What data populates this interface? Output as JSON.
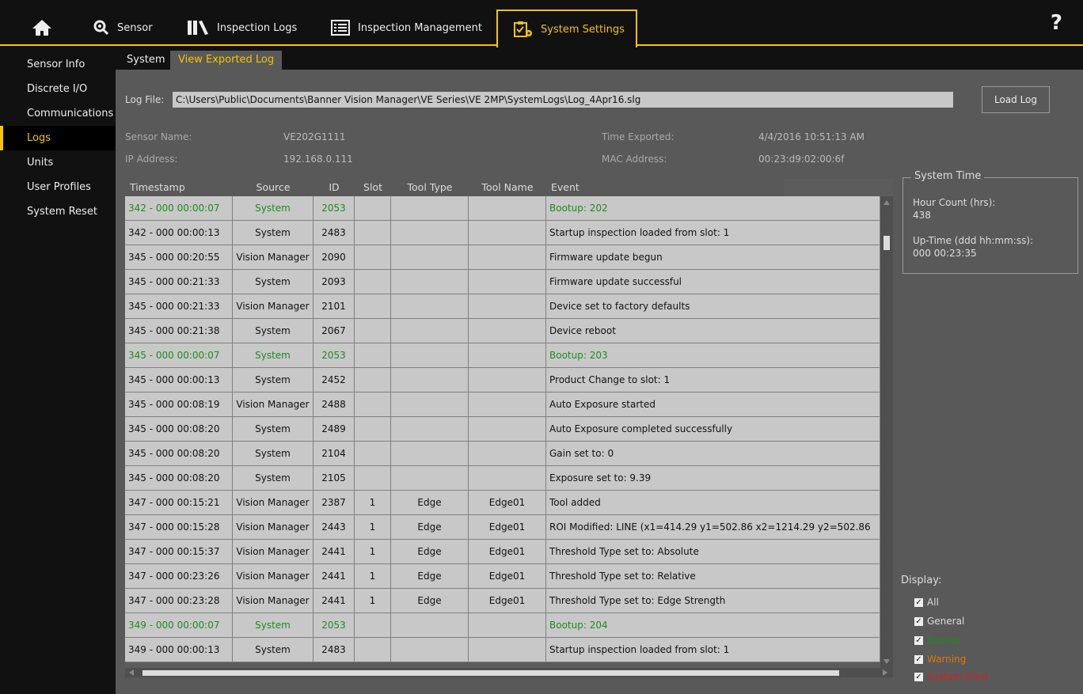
{
  "topnav": {
    "sensor": "Sensor",
    "inspection_logs": "Inspection Logs",
    "inspection_management": "Inspection Management",
    "system_settings": "System Settings",
    "help": "?"
  },
  "sidebar": {
    "items": [
      "Sensor Info",
      "Discrete I/O",
      "Communications",
      "Logs",
      "Units",
      "User Profiles",
      "System Reset"
    ],
    "active": "Logs"
  },
  "subtabs": {
    "system": "System",
    "view_exported_log": "View Exported Log"
  },
  "logfile": {
    "label": "Log File:",
    "path": "C:\\Users\\Public\\Documents\\Banner Vision Manager\\VE Series\\VE 2MP\\SystemLogs\\Log_4Apr16.slg",
    "load_button": "Load Log"
  },
  "info": {
    "sensor_name_label": "Sensor Name:",
    "sensor_name": "VE202G1111",
    "ip_label": "IP Address:",
    "ip": "192.168.0.111",
    "time_exported_label": "Time Exported:",
    "time_exported": "4/4/2016 10:51:13 AM",
    "mac_label": "MAC Address:",
    "mac": "00:23:d9:02:00:6f"
  },
  "table": {
    "columns": [
      "Timestamp",
      "Source",
      "ID",
      "Slot",
      "Tool Type",
      "Tool Name",
      "Event"
    ],
    "rows": [
      [
        "342 - 000 00:00:07",
        "System",
        "2053",
        "",
        "",
        "",
        "Bootup: 202",
        "bootup"
      ],
      [
        "342 - 000 00:00:13",
        "System",
        "2483",
        "",
        "",
        "",
        "Startup inspection loaded from slot: 1",
        "general"
      ],
      [
        "345 - 000 00:20:55",
        "Vision Manager",
        "2090",
        "",
        "",
        "",
        "Firmware update begun",
        "general"
      ],
      [
        "345 - 000 00:21:33",
        "System",
        "2093",
        "",
        "",
        "",
        "Firmware update successful",
        "general"
      ],
      [
        "345 - 000 00:21:33",
        "Vision Manager",
        "2101",
        "",
        "",
        "",
        "Device set to factory defaults",
        "general"
      ],
      [
        "345 - 000 00:21:38",
        "System",
        "2067",
        "",
        "",
        "",
        "Device reboot",
        "general"
      ],
      [
        "345 - 000 00:00:07",
        "System",
        "2053",
        "",
        "",
        "",
        "Bootup: 203",
        "bootup"
      ],
      [
        "345 - 000 00:00:13",
        "System",
        "2452",
        "",
        "",
        "",
        "Product Change to slot: 1",
        "general"
      ],
      [
        "345 - 000 00:08:19",
        "Vision Manager",
        "2488",
        "",
        "",
        "",
        "Auto Exposure started",
        "general"
      ],
      [
        "345 - 000 00:08:20",
        "System",
        "2489",
        "",
        "",
        "",
        "Auto Exposure completed successfully",
        "general"
      ],
      [
        "345 - 000 00:08:20",
        "System",
        "2104",
        "",
        "",
        "",
        "Gain set to:  0",
        "general"
      ],
      [
        "345 - 000 00:08:20",
        "System",
        "2105",
        "",
        "",
        "",
        "Exposure set to:  9.39",
        "general"
      ],
      [
        "347 - 000 00:15:21",
        "Vision Manager",
        "2387",
        "1",
        "Edge",
        "Edge01",
        "Tool added",
        "general"
      ],
      [
        "347 - 000 00:15:28",
        "Vision Manager",
        "2443",
        "1",
        "Edge",
        "Edge01",
        "ROI Modified: LINE (x1=414.29 y1=502.86 x2=1214.29 y2=502.86",
        "general"
      ],
      [
        "347 - 000 00:15:37",
        "Vision Manager",
        "2441",
        "1",
        "Edge",
        "Edge01",
        "Threshold Type set to:  Absolute",
        "general"
      ],
      [
        "347 - 000 00:23:26",
        "Vision Manager",
        "2441",
        "1",
        "Edge",
        "Edge01",
        "Threshold Type set to:  Relative",
        "general"
      ],
      [
        "347 - 000 00:23:28",
        "Vision Manager",
        "2441",
        "1",
        "Edge",
        "Edge01",
        "Threshold Type set to:  Edge Strength",
        "general"
      ],
      [
        "349 - 000 00:00:07",
        "System",
        "2053",
        "",
        "",
        "",
        "Bootup: 204",
        "bootup"
      ],
      [
        "349 - 000 00:00:13",
        "System",
        "2483",
        "",
        "",
        "",
        "Startup inspection loaded from slot: 1",
        "general"
      ]
    ]
  },
  "system_time": {
    "title": "System Time",
    "hour_count_label": "Hour Count (hrs):",
    "hour_count": "438",
    "uptime_label": "Up-Time (ddd hh:mm:ss):",
    "uptime": "000 00:23:35"
  },
  "display": {
    "title": "Display:",
    "options": [
      {
        "label": "All",
        "checked": true,
        "color": "#dddddd"
      },
      {
        "label": "General",
        "checked": true,
        "color": "#dddddd"
      },
      {
        "label": "Bootup",
        "checked": true,
        "color": "#1e8a1e"
      },
      {
        "label": "Warning",
        "checked": true,
        "color": "#e07b00"
      },
      {
        "label": "System Error",
        "checked": true,
        "color": "#d42020"
      }
    ]
  },
  "colors": {
    "accent": "#f5c400",
    "bootup": "#1e8a1e"
  },
  "icons": [
    "home-icon",
    "sensor-icon",
    "inspection-logs-icon",
    "inspection-management-icon",
    "system-settings-icon",
    "help-icon"
  ]
}
